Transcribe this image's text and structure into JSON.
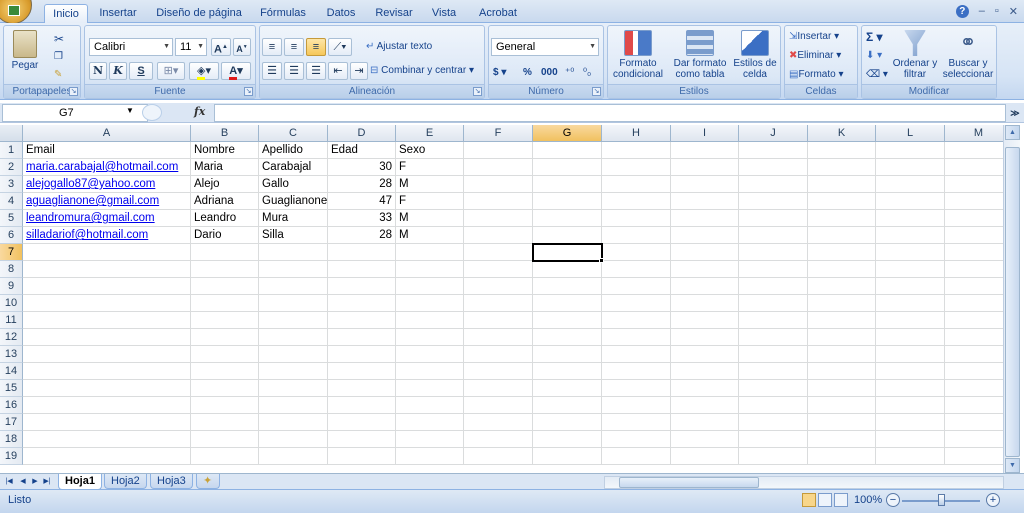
{
  "ribbon": {
    "tabs": [
      "Inicio",
      "Insertar",
      "Diseño de página",
      "Fórmulas",
      "Datos",
      "Revisar",
      "Vista",
      "Acrobat"
    ],
    "active_tab": "Inicio",
    "clipboard": {
      "paste": "Pegar",
      "group": "Portapapeles"
    },
    "font": {
      "name": "Calibri",
      "size": "11",
      "bold": "N",
      "italic": "K",
      "underline": "S",
      "group": "Fuente"
    },
    "alignment": {
      "wrap": "Ajustar texto",
      "merge": "Combinar y centrar",
      "group": "Alineación"
    },
    "number": {
      "format": "General",
      "currency": "$",
      "percent": "%",
      "thousands": "000",
      "inc_decimals": "⁺⁰",
      "dec_decimals": "⁰₀",
      "group": "Número"
    },
    "styles": {
      "conditional": "Formato condicional",
      "as_table": "Dar formato como tabla",
      "cell_styles": "Estilos de celda",
      "group": "Estilos"
    },
    "cells": {
      "insert": "Insertar",
      "delete": "Eliminar",
      "format": "Formato",
      "group": "Celdas"
    },
    "editing": {
      "sort": "Ordenar y filtrar",
      "find": "Buscar y seleccionar",
      "group": "Modificar"
    }
  },
  "formula_bar": {
    "name_box": "G7",
    "fx": "fx",
    "formula": ""
  },
  "grid": {
    "columns": [
      "A",
      "B",
      "C",
      "D",
      "E",
      "F",
      "G",
      "H",
      "I",
      "J",
      "K",
      "L",
      "M"
    ],
    "selected_column": "G",
    "rows": [
      "1",
      "2",
      "3",
      "4",
      "5",
      "6",
      "7",
      "8",
      "9",
      "10",
      "11",
      "12",
      "13",
      "14",
      "15",
      "16",
      "17",
      "18",
      "19"
    ],
    "selected_row": "7",
    "headers": [
      "Email",
      "Nombre",
      "Apellido",
      "Edad",
      "Sexo"
    ],
    "records": [
      [
        "maria.carabajal@hotmail.com",
        "Maria",
        "Carabajal",
        "30",
        "F"
      ],
      [
        "alejogallo87@yahoo.com",
        "Alejo",
        "Gallo",
        "28",
        "M"
      ],
      [
        "aguaglianone@gmail.com",
        "Adriana",
        "Guaglianone",
        "47",
        "F"
      ],
      [
        "leandromura@gmail.com",
        "Leandro",
        "Mura",
        "33",
        "M"
      ],
      [
        "silladariof@hotmail.com",
        "Dario",
        "Silla",
        "28",
        "M"
      ]
    ]
  },
  "sheets": [
    "Hoja1",
    "Hoja2",
    "Hoja3"
  ],
  "active_sheet": "Hoja1",
  "status": {
    "mode": "Listo",
    "zoom": "100%"
  }
}
